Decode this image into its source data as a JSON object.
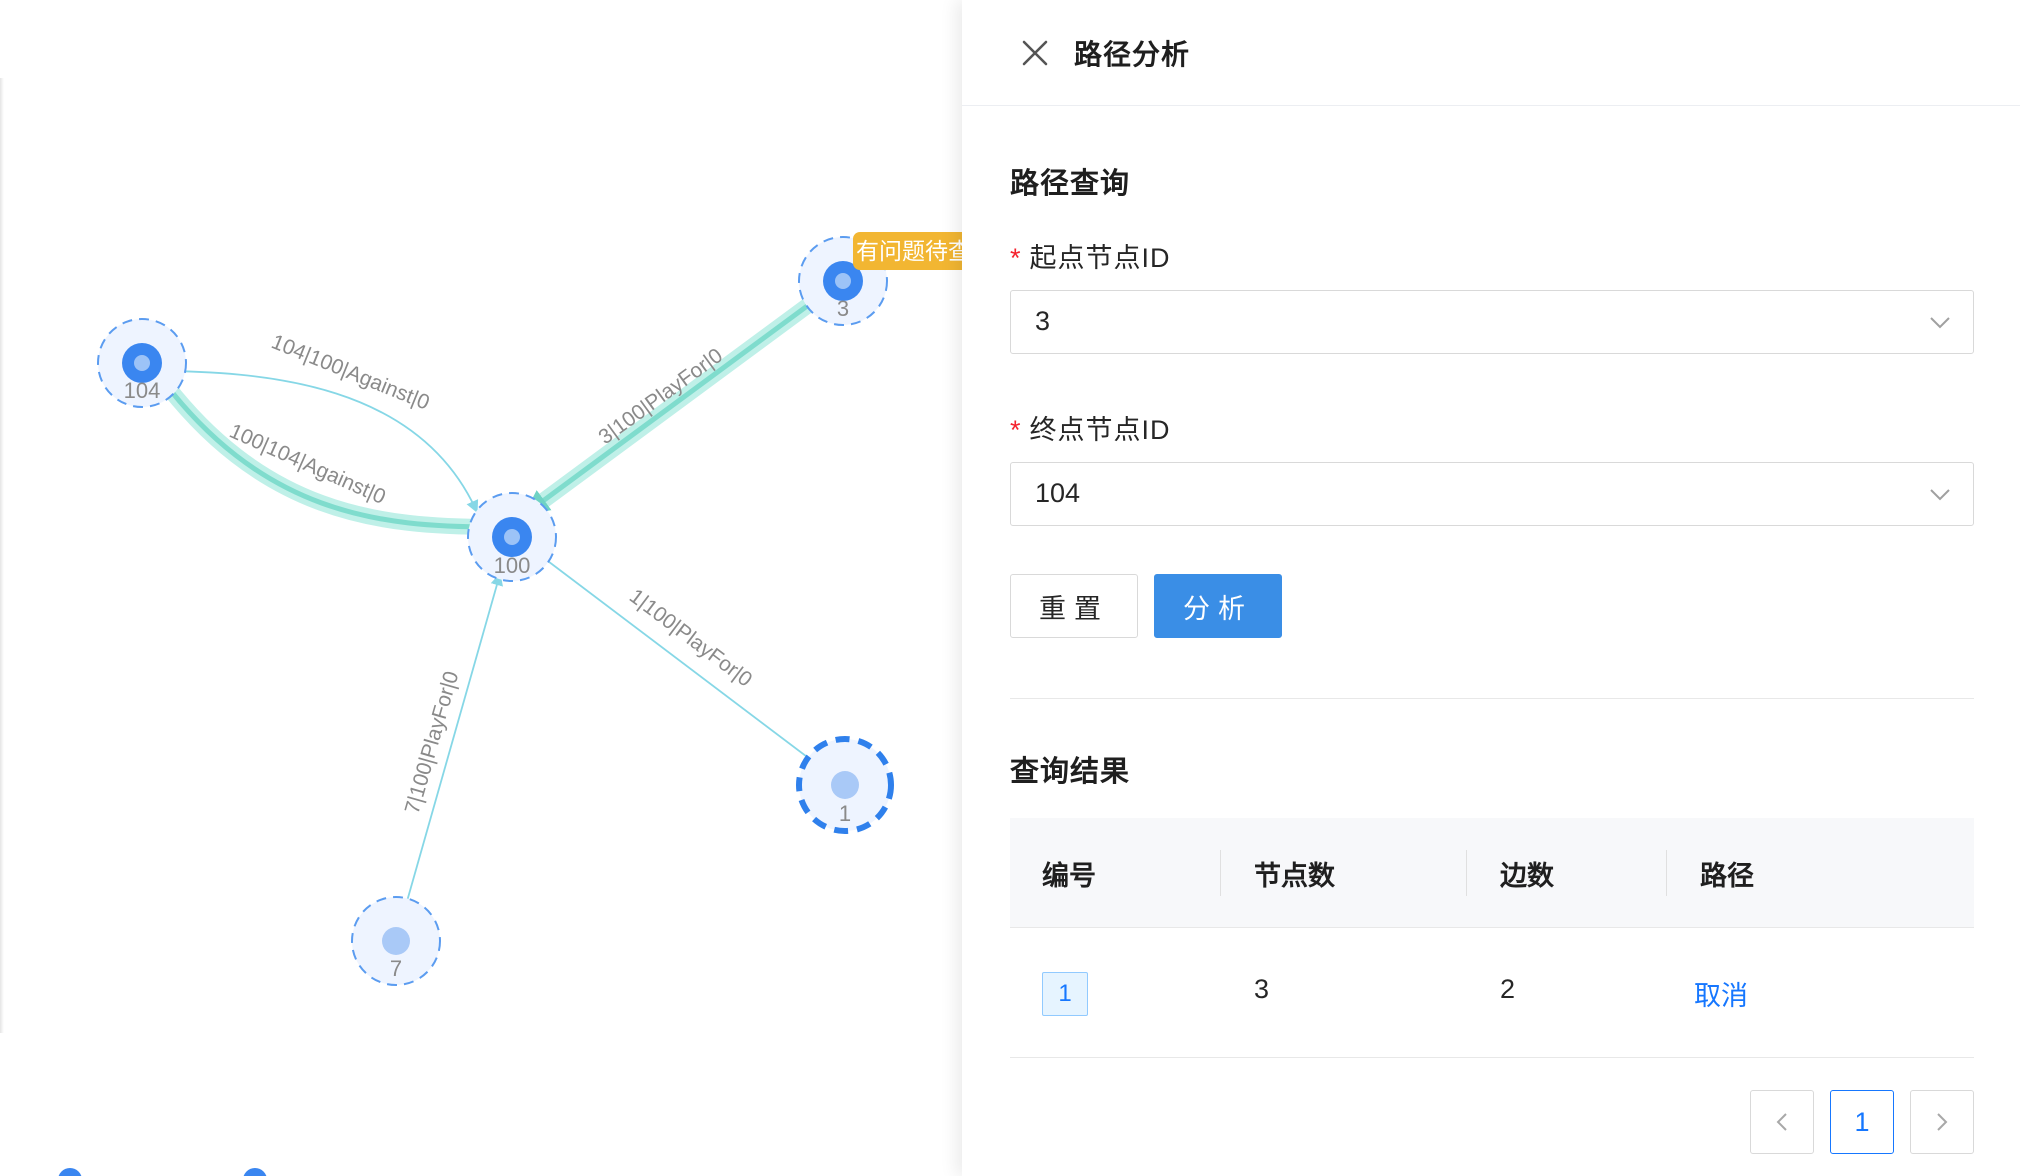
{
  "graph": {
    "nodes": [
      {
        "id": "104",
        "label": "104"
      },
      {
        "id": "100",
        "label": "100"
      },
      {
        "id": "3",
        "label": "3"
      },
      {
        "id": "1",
        "label": "1"
      },
      {
        "id": "7",
        "label": "7"
      }
    ],
    "edges": [
      {
        "label": "104|100|Against|0"
      },
      {
        "label": "100|104|Against|0"
      },
      {
        "label": "3|100|PlayFor|0"
      },
      {
        "label": "1|100|PlayFor|0"
      },
      {
        "label": "7|100|PlayFor|0"
      }
    ],
    "node_tag": "有问题待查"
  },
  "drawer": {
    "title": "路径分析",
    "query_section_title": "路径查询",
    "start_label": "起点节点ID",
    "start_value": "3",
    "end_label": "终点节点ID",
    "end_value": "104",
    "required_mark": "*",
    "reset_label": "重置",
    "analyze_label": "分析",
    "result_section_title": "查询结果",
    "table": {
      "headers": [
        "编号",
        "节点数",
        "边数",
        "路径"
      ],
      "rows": [
        {
          "id": "1",
          "nodes": "3",
          "edges": "2",
          "action": "取消"
        }
      ]
    },
    "pagination": {
      "current": "1"
    }
  },
  "colors": {
    "primary": "#3a8ee6",
    "link": "#1677ff",
    "node_fill": "#3a86f0",
    "node_light": "#a9c9f7",
    "path_highlight": "#86e0d4",
    "edge": "#7fd6e6",
    "tag": "#f2b632",
    "required": "#f5222d"
  }
}
